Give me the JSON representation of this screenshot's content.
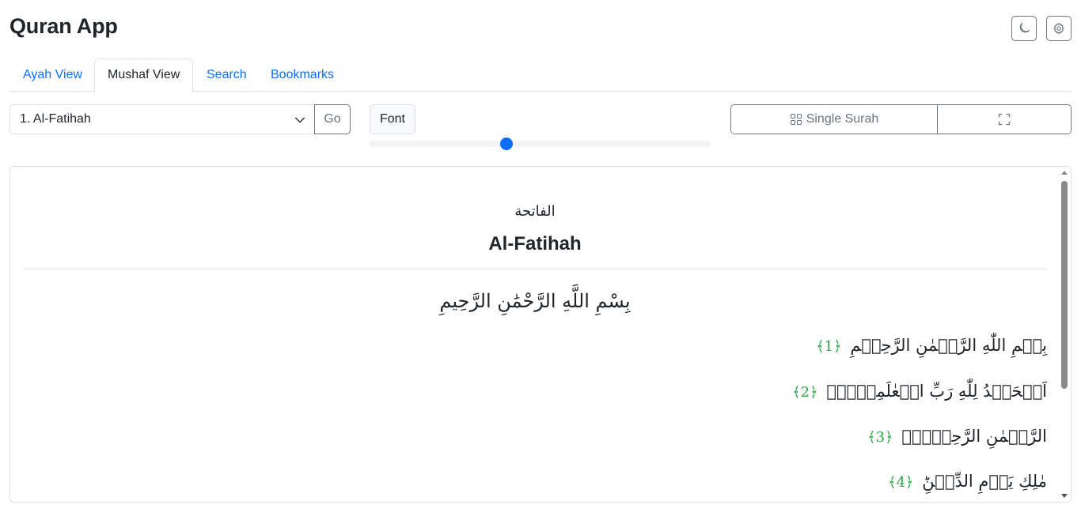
{
  "app": {
    "title": "Quran App"
  },
  "header": {
    "theme_icon": "moon-icon",
    "settings_icon": "gear-icon"
  },
  "tabs": [
    {
      "label": "Ayah View",
      "active": false
    },
    {
      "label": "Mushaf View",
      "active": true
    },
    {
      "label": "Search",
      "active": false
    },
    {
      "label": "Bookmarks",
      "active": false
    }
  ],
  "toolbar": {
    "surah_select": "1. Al-Fatihah",
    "go_label": "Go",
    "font_label": "Font",
    "font_slider_value": 0.4,
    "single_surah_label": "Single Surah",
    "single_surah_icon": "grid-icon",
    "fullscreen_icon": "fullscreen-icon"
  },
  "mushaf": {
    "surah_name_arabic": "الفاتحة",
    "surah_name": "Al-Fatihah",
    "basmala": "بِسْمِ اللَّهِ الرَّحْمَٰنِ الرَّحِيمِ",
    "ayahs": [
      {
        "text": "بِسۡمِ اللّٰهِ الرَّحۡمٰنِ الرَّحِيۡمِ",
        "number": "﴿1﴾"
      },
      {
        "text": "اَلۡحَمۡدُ لِلّٰهِ رَبِّ الۡعٰلَمِيۡنَۙ",
        "number": "﴿2﴾"
      },
      {
        "text": "الرَّحۡمٰنِ الرَّحِيۡمِۙ",
        "number": "﴿3﴾"
      },
      {
        "text": "مٰلِكِ يَوۡمِ الدِّيۡنِؕ",
        "number": "﴿4﴾"
      }
    ]
  },
  "colors": {
    "accent": "#0d6efd",
    "ayah_number": "#28a745",
    "border": "#dee2e6"
  }
}
